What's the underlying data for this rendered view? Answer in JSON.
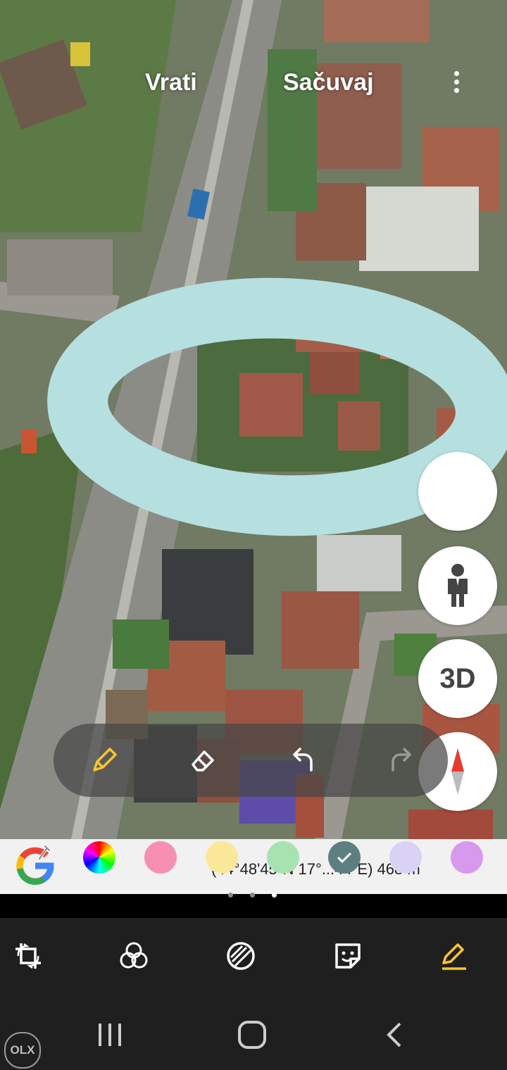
{
  "header": {
    "back_label": "Vrati",
    "save_label": "Sačuvaj",
    "more_icon": "more-vert-icon"
  },
  "map_controls": {
    "street_view_icon": "pegman-icon",
    "tilt_label": "3D",
    "compass_icon": "compass-icon"
  },
  "draw_toolbar": {
    "tools": [
      "pencil-icon",
      "eraser-icon",
      "undo-icon",
      "redo-icon"
    ],
    "active_tool": "pencil",
    "stroke_color": "#b5e0df"
  },
  "palette": {
    "logo": "google-logo",
    "eyedropper_icon": "eyedropper-icon",
    "coordinates_text": "(44°48'45\"N 17°...44\"E) 468 m",
    "swatches": [
      {
        "name": "color-wheel",
        "color": "multicolor"
      },
      {
        "name": "pink",
        "color": "#f78fb3"
      },
      {
        "name": "yellow",
        "color": "#fbe89a"
      },
      {
        "name": "green",
        "color": "#a6e3b0"
      },
      {
        "name": "teal-selected",
        "color": "#5e7f80",
        "selected": true
      },
      {
        "name": "lavender",
        "color": "#d9d2f5"
      },
      {
        "name": "violet",
        "color": "#d699ec"
      }
    ]
  },
  "page_indicator": {
    "count": 3,
    "active_index": 2
  },
  "edit_bar": {
    "tools": [
      "crop-rotate-icon",
      "filters-icon",
      "adjust-icon",
      "sticker-icon",
      "draw-icon"
    ],
    "active_tool": "draw",
    "accent_color": "#f7c531"
  },
  "nav_bar": {
    "buttons": [
      "recents-icon",
      "home-icon",
      "back-icon"
    ]
  },
  "watermark": {
    "text": "OLX"
  }
}
